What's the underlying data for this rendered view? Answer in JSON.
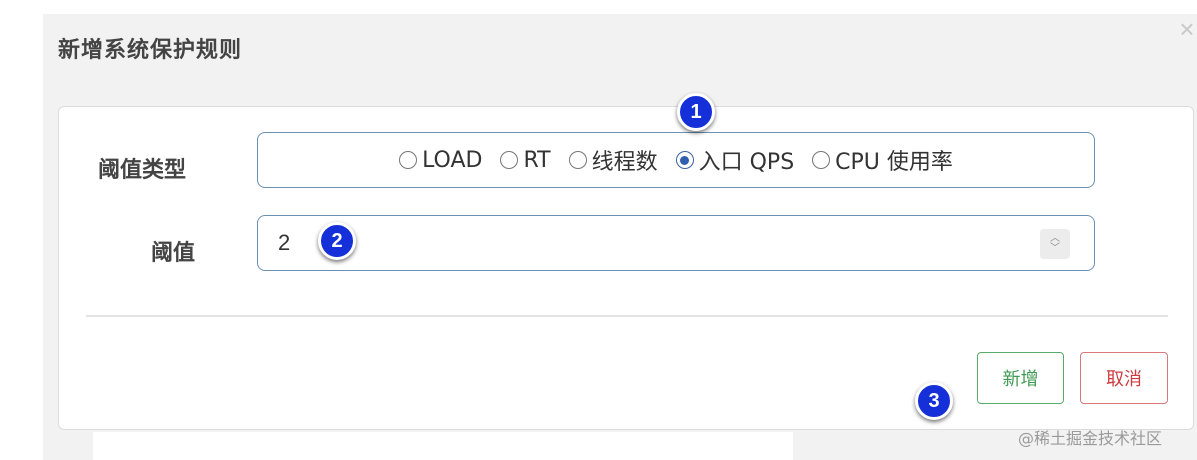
{
  "dialog": {
    "title": "新增系统保护规则",
    "close_icon": "close-icon"
  },
  "form": {
    "threshold_type_label": "阈值类型",
    "threshold_type_options": [
      {
        "label": "LOAD",
        "selected": false
      },
      {
        "label": "RT",
        "selected": false
      },
      {
        "label": "线程数",
        "selected": false
      },
      {
        "label": "入口 QPS",
        "selected": true
      },
      {
        "label": "CPU 使用率",
        "selected": false
      }
    ],
    "threshold_label": "阈值",
    "threshold_value": "2"
  },
  "buttons": {
    "add_label": "新增",
    "cancel_label": "取消"
  },
  "annotations": [
    "1",
    "2",
    "3"
  ],
  "watermark": "@稀土掘金技术社区",
  "colors": {
    "add_button": "#3f9b52",
    "cancel_button": "#cc3b3f",
    "badge": "#1530d9",
    "radio_selected": "#2f5fae"
  }
}
